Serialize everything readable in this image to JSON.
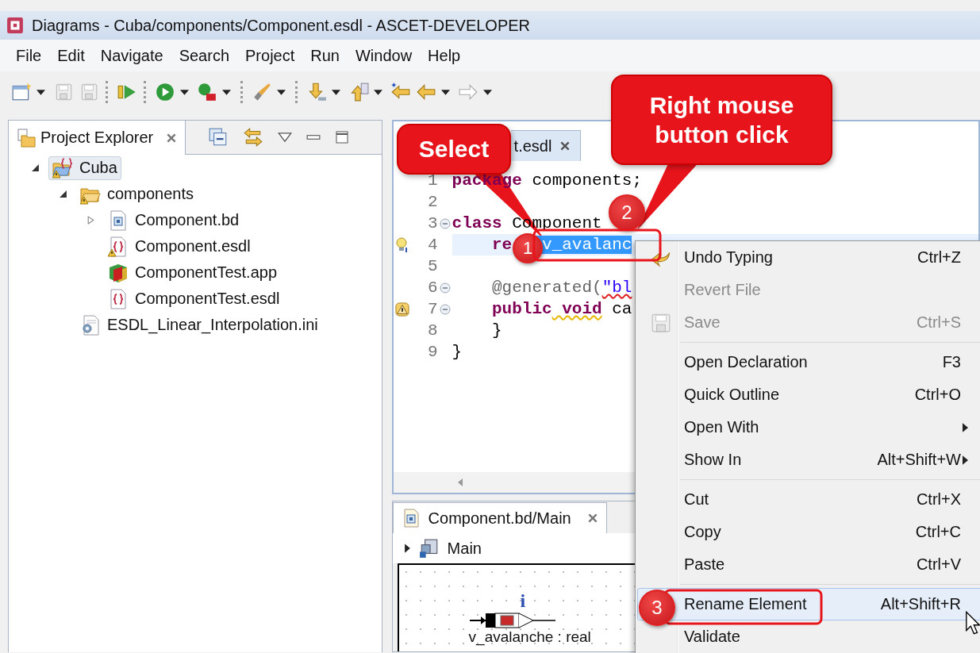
{
  "window": {
    "title": "Diagrams - Cuba/components/Component.esdl - ASCET-DEVELOPER"
  },
  "menu": [
    "File",
    "Edit",
    "Navigate",
    "Search",
    "Project",
    "Run",
    "Window",
    "Help"
  ],
  "project_explorer": {
    "tab": "Project Explorer",
    "tree": [
      {
        "label": "Cuba",
        "kind": "project",
        "warning": true,
        "selected": true,
        "expanded": true,
        "children": [
          {
            "label": "components",
            "kind": "folder",
            "warning": true,
            "selected": false,
            "expanded": true,
            "children": [
              {
                "label": "Component.bd",
                "kind": "diagram",
                "warning": false,
                "selected": false,
                "expanded": false
              },
              {
                "label": "Component.esdl",
                "kind": "esdl",
                "warning": true,
                "selected": false
              },
              {
                "label": "ComponentTest.app",
                "kind": "app",
                "warning": false,
                "selected": false
              },
              {
                "label": "ComponentTest.esdl",
                "kind": "esdl",
                "warning": false,
                "selected": false
              }
            ]
          },
          {
            "label": "ESDL_Linear_Interpolation.ini",
            "kind": "ini",
            "warning": false,
            "selected": false
          }
        ]
      }
    ]
  },
  "editor": {
    "tab": "t.esdl",
    "lines": [
      {
        "number": "1",
        "current": false,
        "tokens": [
          {
            "text": "package",
            "kind": "keyword"
          },
          {
            "text": " components;",
            "kind": "plain"
          }
        ]
      },
      {
        "number": "2",
        "current": false
      },
      {
        "number": "3",
        "current": false,
        "fold": true,
        "tokens": [
          {
            "text": "class",
            "kind": "keyword"
          },
          {
            "text": " Component",
            "kind": "plain"
          }
        ]
      },
      {
        "number": "4",
        "current": true,
        "quick_fix": true,
        "tokens": [
          {
            "text": "    re  ",
            "kind": "keyword"
          },
          {
            "text": " v_avalanc",
            "kind": "selection"
          }
        ]
      },
      {
        "number": "5",
        "current": false
      },
      {
        "number": "6",
        "current": false,
        "fold": true,
        "tokens": [
          {
            "text": "    @generated(",
            "kind": "annotation"
          },
          {
            "text": "\"bl",
            "kind": "string",
            "error_underline": true
          }
        ]
      },
      {
        "number": "7",
        "current": false,
        "fold": true,
        "has_warning": true,
        "tokens": [
          {
            "text": "    public",
            "kind": "keyword"
          },
          {
            "text": " void",
            "kind": "keyword",
            "warning_underline": true
          },
          {
            "text": " ca",
            "kind": "plain"
          }
        ]
      },
      {
        "number": "8",
        "current": false,
        "tokens": [
          {
            "text": "    }",
            "kind": "plain"
          }
        ]
      },
      {
        "number": "9",
        "current": false,
        "tokens": [
          {
            "text": "}",
            "kind": "plain"
          }
        ]
      }
    ]
  },
  "diagram_view": {
    "tab": "Component.bd/Main",
    "breadcrumb": "Main",
    "element_marker": "i",
    "element_label": "v_avalanche : real"
  },
  "context_menu": [
    {
      "kind": "undo-item",
      "label": "Undo Typing",
      "shortcut": "Ctrl+Z",
      "disabled": false,
      "selected": false
    },
    {
      "kind": "item",
      "label": "Revert File",
      "disabled": true,
      "selected": false
    },
    {
      "kind": "save-item",
      "label": "Save",
      "shortcut": "Ctrl+S",
      "disabled": true,
      "selected": false
    },
    {
      "kind": "separator"
    },
    {
      "kind": "item",
      "label": "Open Declaration",
      "shortcut": "F3",
      "disabled": false,
      "selected": false
    },
    {
      "kind": "item",
      "label": "Quick Outline",
      "shortcut": "Ctrl+O",
      "disabled": false,
      "selected": false
    },
    {
      "kind": "item",
      "label": "Open With",
      "submenu": true,
      "disabled": false,
      "selected": false
    },
    {
      "kind": "item",
      "label": "Show In",
      "shortcut": "Alt+Shift+W",
      "submenu": true,
      "disabled": false,
      "selected": false
    },
    {
      "kind": "separator"
    },
    {
      "kind": "item",
      "label": "Cut",
      "shortcut": "Ctrl+X",
      "disabled": false,
      "selected": false
    },
    {
      "kind": "item",
      "label": "Copy",
      "shortcut": "Ctrl+C",
      "disabled": false,
      "selected": false
    },
    {
      "kind": "item",
      "label": "Paste",
      "shortcut": "Ctrl+V",
      "disabled": false,
      "selected": false
    },
    {
      "kind": "separator"
    },
    {
      "kind": "item",
      "label": "Rename Element",
      "shortcut": "Alt+Shift+R",
      "disabled": false,
      "selected": true
    },
    {
      "kind": "item",
      "label": "Validate",
      "disabled": false,
      "selected": false
    }
  ],
  "annotations": {
    "callouts": [
      "Select",
      "Right mouse button click"
    ],
    "steps": [
      "1",
      "2",
      "3"
    ]
  }
}
